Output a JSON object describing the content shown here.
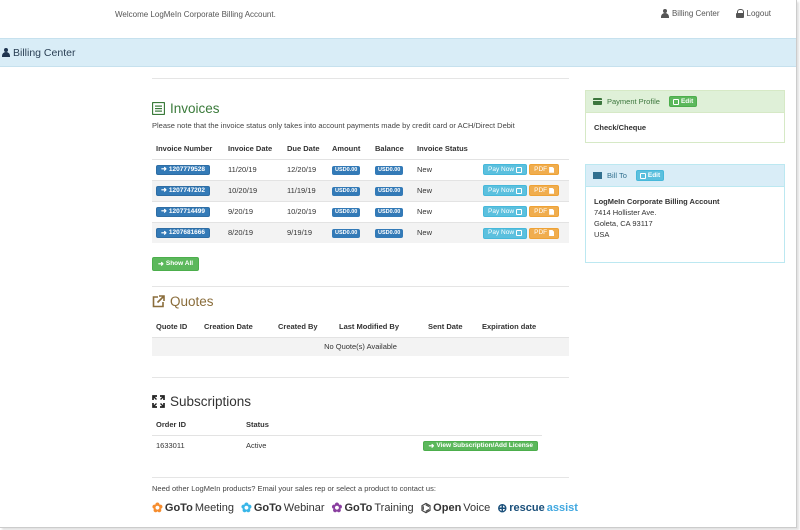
{
  "top": {
    "welcome": "Welcome LogMeIn Corporate Billing Account.",
    "billing_center_link": "Billing Center",
    "logout_link": "Logout"
  },
  "header": {
    "title": "Billing Center"
  },
  "invoices": {
    "title": "Invoices",
    "note": "Please note that the invoice status only takes into account payments made by credit card or ACH/Direct Debit",
    "columns": [
      "Invoice Number",
      "Invoice Date",
      "Due Date",
      "Amount",
      "Balance",
      "Invoice Status"
    ],
    "rows": [
      {
        "number": "1207779528",
        "date": "11/20/19",
        "due": "12/20/19",
        "amount": "USD0.00",
        "balance": "USD0.00",
        "status": "New"
      },
      {
        "number": "1207747202",
        "date": "10/20/19",
        "due": "11/19/19",
        "amount": "USD0.00",
        "balance": "USD0.00",
        "status": "New"
      },
      {
        "number": "1207714499",
        "date": "9/20/19",
        "due": "10/20/19",
        "amount": "USD0.00",
        "balance": "USD0.00",
        "status": "New"
      },
      {
        "number": "1207681666",
        "date": "8/20/19",
        "due": "9/19/19",
        "amount": "USD0.00",
        "balance": "USD0.00",
        "status": "New"
      }
    ],
    "pay_now": "Pay Now",
    "pdf": "PDF",
    "show_all": "Show All"
  },
  "quotes": {
    "title": "Quotes",
    "columns": [
      "Quote ID",
      "Creation Date",
      "Created By",
      "Last Modified By",
      "Sent Date",
      "Expiration date"
    ],
    "empty": "No Quote(s) Available"
  },
  "subscriptions": {
    "title": "Subscriptions",
    "columns": [
      "Order ID",
      "Status"
    ],
    "rows": [
      {
        "order_id": "1633011",
        "status": "Active"
      }
    ],
    "view_button": "View Subscription/Add License"
  },
  "payment_profile": {
    "title": "Payment Profile",
    "edit": "Edit",
    "method": "Check/Cheque"
  },
  "bill_to": {
    "title": "Bill To",
    "edit": "Edit",
    "name": "LogMeIn Corporate Billing Account",
    "street": "7414 Hollister Ave.",
    "city": "Goleta, CA 93117",
    "country": "USA"
  },
  "products": {
    "text": "Need other LogMeIn products? Email your sales rep or select a product to contact us:",
    "logos": [
      {
        "pre": "GoTo",
        "post": "Meeting"
      },
      {
        "pre": "GoTo",
        "post": "Webinar"
      },
      {
        "pre": "GoTo",
        "post": "Training"
      },
      {
        "pre": "Open",
        "post": "Voice"
      },
      {
        "pre": "rescue",
        "post": "assist"
      }
    ]
  },
  "colors": {
    "header_bg": "#d9edf7",
    "primary": "#337ab7",
    "info": "#5bc0de",
    "warning": "#f0ad4e",
    "success": "#5cb85c"
  }
}
